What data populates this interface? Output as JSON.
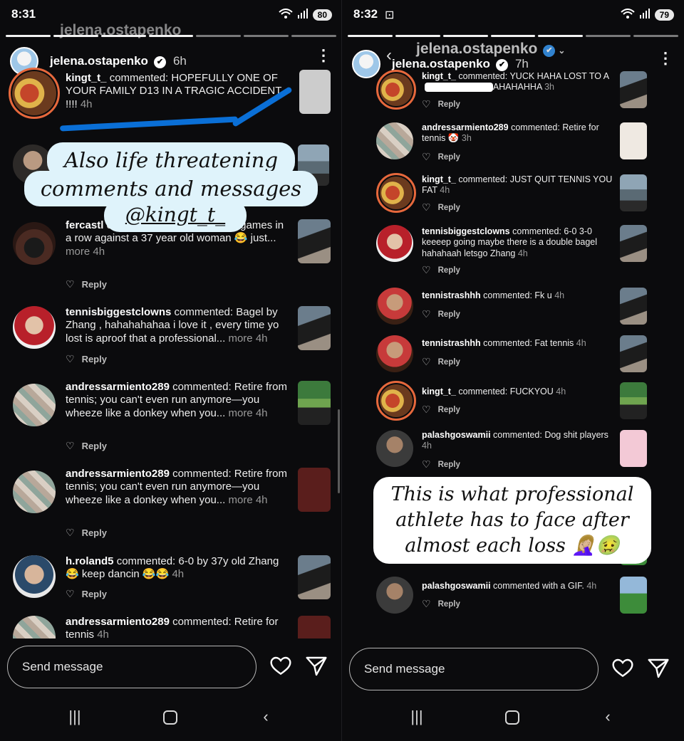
{
  "left": {
    "status": {
      "time": "8:31",
      "battery": "80"
    },
    "ghost_header": "jelena.ostapenko",
    "story": {
      "user": "jelena.ostapenko",
      "time": "6h"
    },
    "comments": [
      {
        "user": "kingt_t_",
        "verb": "commented:",
        "text": "HOPEFULLY ONE OF YOUR FAMILY D13 IN A TRAGIC ACCIDENT !!!!",
        "more": "",
        "time": "4h",
        "reply": ""
      },
      {
        "user": "fercastl",
        "verb": "",
        "text": "of dancing tango, lose eight games in a row against a 37 year old woman 😂 just...",
        "more": "more",
        "time": "4h",
        "reply": "Reply"
      },
      {
        "user": "tennisbiggestclowns",
        "verb": "commented:",
        "text": "Bagel by Zhang , hahahahahaa i love it , every time yo lost is aproof that a professional...",
        "more": "more",
        "time": "4h",
        "reply": "Reply"
      },
      {
        "user": "andressarmiento289",
        "verb": "commented:",
        "text": "Retire from tennis; you can't even run anymore—you wheeze like a donkey when you...",
        "more": "more",
        "time": "4h",
        "reply": "Reply"
      },
      {
        "user": "andressarmiento289",
        "verb": "commented:",
        "text": "Retire from tennis; you can't even run anymore—you wheeze like a donkey when you...",
        "more": "more",
        "time": "4h",
        "reply": "Reply"
      },
      {
        "user": "h.roland5",
        "verb": "commented:",
        "text": "6-0 by 37y old Zhang 😂 keep dancin 😂😂",
        "more": "",
        "time": "4h",
        "reply": "Reply"
      },
      {
        "user": "andressarmiento289",
        "verb": "commented:",
        "text": "Retire for tennis",
        "more": "",
        "time": "4h",
        "reply": ""
      }
    ],
    "sticker": {
      "line1": "Also life threatening",
      "line2": "comments and messages",
      "line3": "@kingt_t_"
    },
    "message_placeholder": "Send message"
  },
  "right": {
    "status": {
      "time": "8:32",
      "battery": "79"
    },
    "ghost_header": "jelena.ostapenko",
    "story": {
      "user": "jelena.ostapenko",
      "time": "7h"
    },
    "comments": [
      {
        "user": "kingt_t_",
        "verb": "commented:",
        "text": "YUCK HAHA LOST TO A",
        "text2": "BAHAHAHHA",
        "time": "3h",
        "reply": "Reply"
      },
      {
        "user": "andressarmiento289",
        "verb": "commented:",
        "text": "Retire for tennis 🤡",
        "time": "3h",
        "reply": "Reply"
      },
      {
        "user": "kingt_t_",
        "verb": "commented:",
        "text": "JUST QUIT TENNIS YOU FAT",
        "time": "4h",
        "reply": "Reply"
      },
      {
        "user": "tennisbiggestclowns",
        "verb": "commented:",
        "text": "6-0 3-0 keeeep going maybe there is a double bagel hahahaah letsgo Zhang",
        "time": "4h",
        "reply": "Reply"
      },
      {
        "user": "tennistrashhh",
        "verb": "commented:",
        "text": "Fk u",
        "time": "4h",
        "reply": "Reply"
      },
      {
        "user": "tennistrashhh",
        "verb": "commented:",
        "text": "Fat tennis",
        "time": "4h",
        "reply": "Reply"
      },
      {
        "user": "kingt_t_",
        "verb": "commented:",
        "text": "FUCKYOU",
        "time": "4h",
        "reply": "Reply"
      },
      {
        "user": "palashgoswamii",
        "verb": "commented:",
        "text": "Dog shit players",
        "time": "4h",
        "reply": "Reply"
      },
      {
        "user": "palashgoswamii",
        "verb": "commented with a GIF.",
        "text": "",
        "time": "4h",
        "reply": "Reply"
      }
    ],
    "sticker": {
      "line1": "This is what professional",
      "line2": "athlete has to face after",
      "line3": "almost each loss 🤦🏼‍♀️🤢"
    },
    "message_placeholder": "Send message"
  },
  "icons": [
    "wifi-icon",
    "signal-icon",
    "battery-icon",
    "verified-badge-icon",
    "more-options-icon",
    "heart-icon",
    "send-icon",
    "recents-nav-icon",
    "home-nav-icon",
    "back-nav-icon",
    "back-chevron-icon",
    "screenshot-icon"
  ],
  "colors": {
    "background": "#0b0b0d",
    "verified_blue": "#3897f0",
    "marker_blue": "#0a6fd6",
    "sticker_bg": "#dff3fb",
    "story_ring": "#e6683c"
  }
}
